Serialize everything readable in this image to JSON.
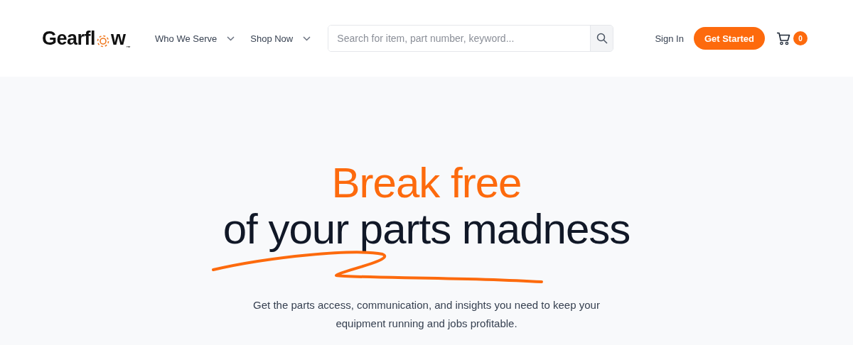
{
  "header": {
    "logo": {
      "before": "Gearfl",
      "after": "w",
      "mark": "™"
    },
    "nav": [
      {
        "label": "Who We Serve"
      },
      {
        "label": "Shop Now"
      }
    ],
    "search": {
      "placeholder": "Search for item, part number, keyword..."
    },
    "sign_in": "Sign In",
    "cta": "Get Started",
    "cart_count": "0"
  },
  "hero": {
    "headline_accent": "Break free",
    "headline": "of your parts madness",
    "subtitle": "Get the parts access, communication, and insights you need to keep your equipment running and jobs profitable."
  }
}
